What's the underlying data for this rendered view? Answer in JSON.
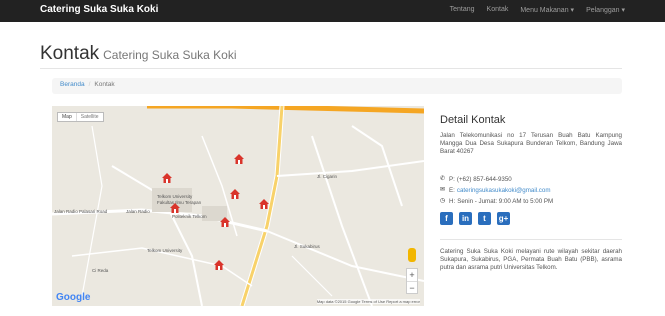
{
  "navbar": {
    "brand": "Catering Suka Suka Koki",
    "items": [
      "Tentang",
      "Kontak",
      "Menu Makanan ▾",
      "Pelanggan ▾"
    ]
  },
  "page": {
    "title": "Kontak",
    "subtitle": "Catering Suka Suka Koki"
  },
  "breadcrumb": {
    "home": "Beranda",
    "separator": "/",
    "current": "Kontak"
  },
  "map": {
    "type_controls": [
      "Map",
      "Satellite"
    ],
    "labels": [
      "Telkom University",
      "Fakultas Ilmu Terapan",
      "Jalan Radio Palasari Road",
      "Jalan Radio",
      "Politeknik Telkom",
      "Telkom University",
      "Ci Reda",
      "Jl. Sukabirus",
      "Jl. Cigarin"
    ],
    "logo": "Google",
    "attribution": "Map data ©2015 Google   Terms of Use   Report a map error",
    "zoom_in": "+",
    "zoom_out": "−"
  },
  "details": {
    "title": "Detail Kontak",
    "address": "Jalan Telekomunikasi no 17 Terusan Buah Batu Kampung Mangga Dua Desa Sukapura Bunderan Telkom, Bandung Jawa Barat 40267",
    "phone_prefix": "P:",
    "phone": "(+62) 857-644-9350",
    "email_prefix": "E:",
    "email": "cateringsukasukakoki@gmail.com",
    "hours_prefix": "H:",
    "hours": "Senin - Jumat: 9:00 AM to 5:00 PM",
    "description": "Catering Suka Suka Koki melayani rute wilayah sekitar daerah Sukapura, Sukabirus, PGA, Permata Buah Batu (PBB), asrama putra dan asrama putri Universitas Telkom."
  },
  "colors": {
    "navbar_bg": "#222222",
    "link": "#428bca",
    "social": "#2a6ebd",
    "marker": "#d9342b"
  },
  "icons": {
    "phone": "phone-icon",
    "email": "envelope-icon",
    "hours": "clock-icon",
    "socials": [
      "facebook-icon",
      "linkedin-icon",
      "twitter-icon",
      "google-plus-icon"
    ]
  }
}
